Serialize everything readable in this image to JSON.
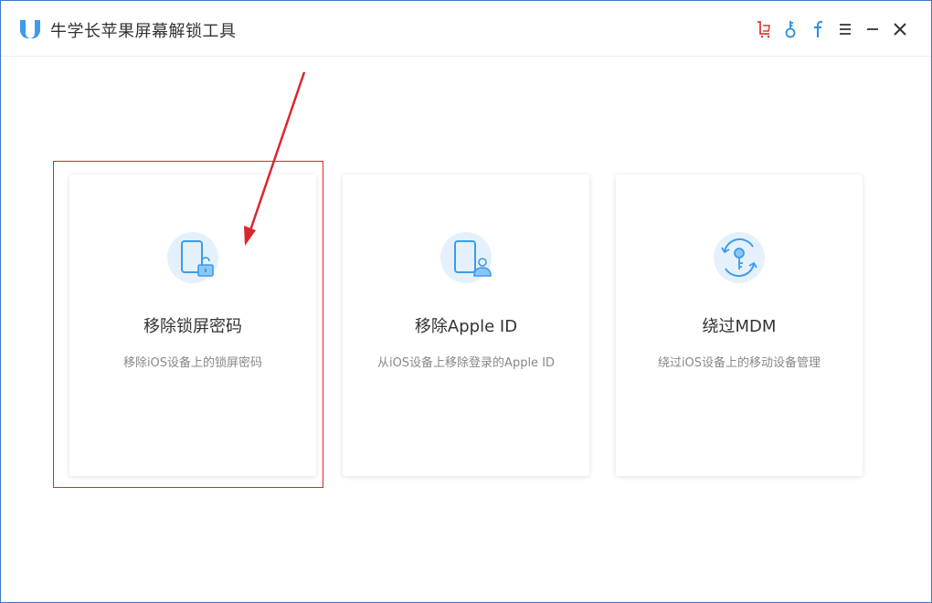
{
  "app": {
    "title": "牛学长苹果屏幕解锁工具",
    "brand_color": "#3d9be9"
  },
  "titlebar_controls": [
    {
      "name": "cart-icon",
      "color": "#e03b3b"
    },
    {
      "name": "key-icon",
      "color": "#2e8fe0"
    },
    {
      "name": "facebook-icon",
      "color": "#2e8fe0"
    },
    {
      "name": "menu-icon",
      "color": "#333333"
    },
    {
      "name": "minimize-icon",
      "color": "#333333"
    },
    {
      "name": "close-icon",
      "color": "#333333"
    }
  ],
  "cards": [
    {
      "title": "移除锁屏密码",
      "description": "移除iOS设备上的锁屏密码",
      "icon": "phone-lock-icon",
      "highlighted": true
    },
    {
      "title": "移除Apple ID",
      "description": "从iOS设备上移除登录的Apple ID",
      "icon": "phone-user-icon",
      "highlighted": false
    },
    {
      "title": "绕过MDM",
      "description": "绕过iOS设备上的移动设备管理",
      "icon": "key-refresh-icon",
      "highlighted": false
    }
  ],
  "annotation": {
    "color": "#d9262e"
  }
}
